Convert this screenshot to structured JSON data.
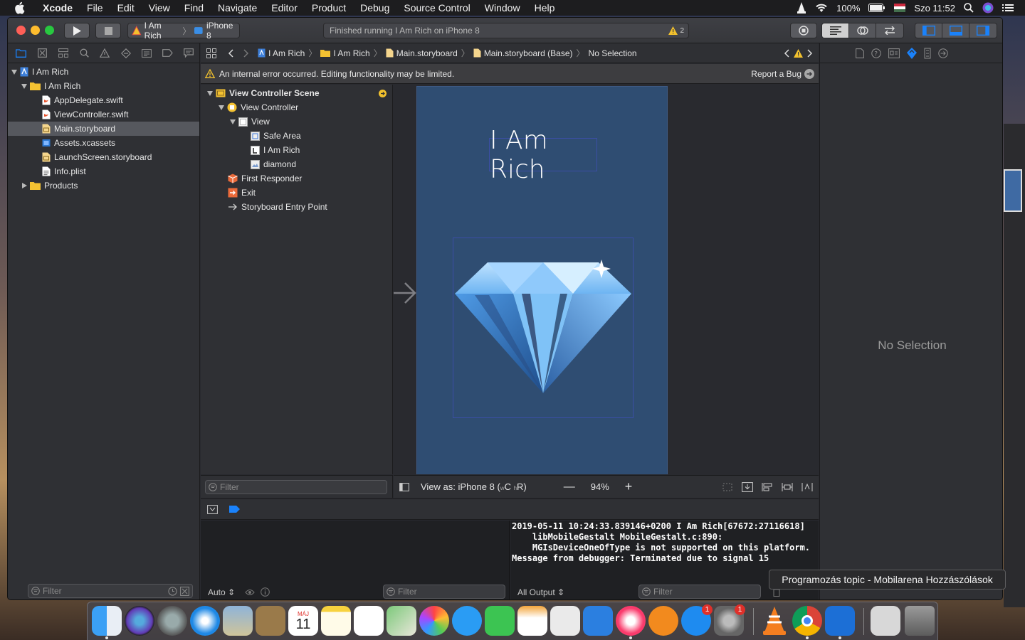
{
  "menubar": {
    "app": "Xcode",
    "items": [
      "File",
      "Edit",
      "View",
      "Find",
      "Navigate",
      "Editor",
      "Product",
      "Debug",
      "Source Control",
      "Window",
      "Help"
    ],
    "battery": "100%",
    "clock": "Szo 11:52"
  },
  "toolbar": {
    "scheme_target": "I Am Rich",
    "scheme_device": "iPhone 8",
    "activity_text": "Finished running I Am Rich on iPhone 8",
    "warning_count": "2"
  },
  "navigator": {
    "project": "I Am Rich",
    "group": "I Am Rich",
    "files": [
      "AppDelegate.swift",
      "ViewController.swift",
      "Main.storyboard",
      "Assets.xcassets",
      "LaunchScreen.storyboard",
      "Info.plist"
    ],
    "products": "Products",
    "filter_placeholder": "Filter"
  },
  "jumpbar": {
    "crumbs": [
      "I Am Rich",
      "I Am Rich",
      "Main.storyboard",
      "Main.storyboard (Base)",
      "No Selection"
    ]
  },
  "errorbar": {
    "message": "An internal error occurred. Editing functionality may be limited.",
    "report": "Report a Bug"
  },
  "outline": {
    "scene": "View Controller Scene",
    "view_controller": "View Controller",
    "view": "View",
    "safe_area": "Safe Area",
    "label": "I Am Rich",
    "image": "diamond",
    "first_responder": "First Responder",
    "exit": "Exit",
    "entry_point": "Storyboard Entry Point",
    "filter_placeholder": "Filter"
  },
  "canvas": {
    "title_label": "I Am Rich",
    "view_as": "View as: iPhone 8 (",
    "size_class_w": "w",
    "size_class_c": "C",
    "size_class_h": "h",
    "size_class_r": "R)",
    "zoom": "94%"
  },
  "console": {
    "lines": [
      "2019-05-11 10:24:33.839146+0200 I Am Rich[67672:27116618]",
      "    libMobileGestalt MobileGestalt.c:890:",
      "    MGIsDeviceOneOfType is not supported on this platform.",
      "Message from debugger: Terminated due to signal 15"
    ],
    "auto": "Auto",
    "all_output": "All Output",
    "filter_placeholder": "Filter"
  },
  "inspector": {
    "empty": "No Selection"
  },
  "tooltip": "Programozás topic - Mobilarena Hozzászólások",
  "dock": {
    "calendar_month": "MÁJ",
    "calendar_day": "11",
    "appstore_badge": "1",
    "prefs_badge": "1"
  },
  "colors": {
    "window_bg": "#292a2f",
    "device_bg": "#2f4d72",
    "accent": "#1a82fb",
    "warning": "#f2c12e"
  }
}
